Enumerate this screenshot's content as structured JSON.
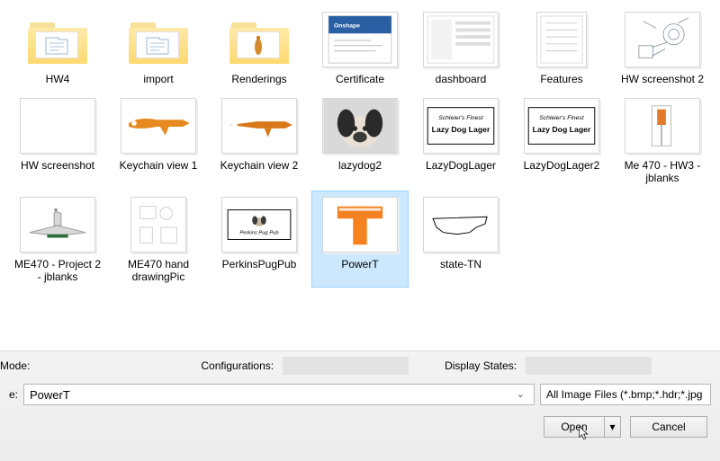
{
  "files": {
    "row": [
      {
        "label": "HW4",
        "kind": "folder"
      },
      {
        "label": "import",
        "kind": "folder"
      },
      {
        "label": "Renderings",
        "kind": "folder-render"
      },
      {
        "label": "Certificate",
        "kind": "cert"
      },
      {
        "label": "dashboard",
        "kind": "dash"
      },
      {
        "label": "Features",
        "kind": "features"
      },
      {
        "label": "HW screenshot 2",
        "kind": "hwss2"
      },
      {
        "label": "HW screenshot",
        "kind": "blank"
      },
      {
        "label": "Keychain view 1",
        "kind": "keychain1"
      },
      {
        "label": "Keychain view 2",
        "kind": "keychain2"
      },
      {
        "label": "lazydog2",
        "kind": "lazydog2"
      },
      {
        "label": "LazyDogLager",
        "kind": "lazylager"
      },
      {
        "label": "LazyDogLager2",
        "kind": "lazylager"
      },
      {
        "label": "Me 470 - HW3 - jblanks",
        "kind": "me470hw3"
      },
      {
        "label": "ME470 - Project 2 - jblanks",
        "kind": "plane"
      },
      {
        "label": "ME470 hand drawingPic",
        "kind": "drawing"
      },
      {
        "label": "PerkinsPugPub",
        "kind": "pugpub"
      },
      {
        "label": "PowerT",
        "kind": "powert",
        "selected": true
      },
      {
        "label": "state-TN",
        "kind": "tn"
      }
    ]
  },
  "bottom": {
    "mode_label": "Mode:",
    "config_label": "Configurations:",
    "display_label": "Display States:",
    "filename_label_prefix": "e:",
    "filename_value": "PowerT",
    "filter_value": "All Image Files (*.bmp;*.hdr;*.jpg",
    "open_label": "Open",
    "cancel_label": "Cancel"
  }
}
